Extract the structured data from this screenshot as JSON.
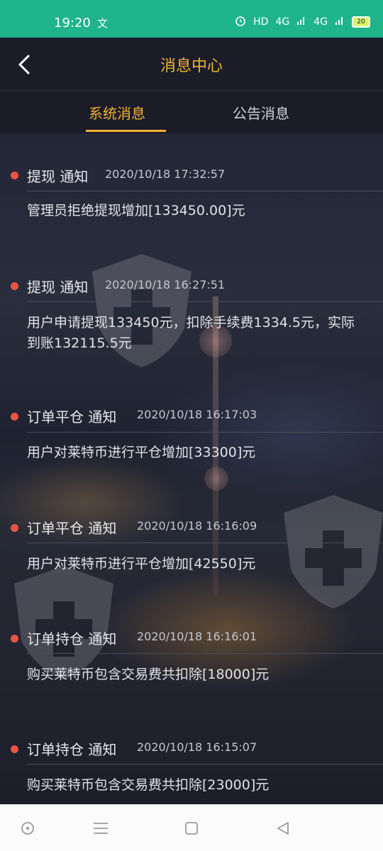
{
  "status_bar": {
    "time": "19:20",
    "sub_glyph": "文",
    "network": "HD",
    "signal1": "4G",
    "signal2": "4G",
    "battery": "20"
  },
  "header": {
    "title": "消息中心"
  },
  "tabs": [
    {
      "label": "系统消息",
      "active": true
    },
    {
      "label": "公告消息",
      "active": false
    }
  ],
  "messages": [
    {
      "type": "提现 通知",
      "time": "2020/10/18 17:32:57",
      "body": "管理员拒绝提现增加[133450.00]元"
    },
    {
      "type": "提现 通知",
      "time": "2020/10/18 16:27:51",
      "body": "用户申请提现133450元，扣除手续费1334.5元，实际到账132115.5元"
    },
    {
      "type": "订单平仓 通知",
      "time": "2020/10/18 16:17:03",
      "body": "用户对莱特币进行平仓增加[33300]元"
    },
    {
      "type": "订单平仓 通知",
      "time": "2020/10/18 16:16:09",
      "body": "用户对莱特币进行平仓增加[42550]元"
    },
    {
      "type": "订单持仓 通知",
      "time": "2020/10/18 16:16:01",
      "body": "购买莱特币包含交易费共扣除[18000]元"
    },
    {
      "type": "订单持仓 通知",
      "time": "2020/10/18 16:15:07",
      "body": "购买莱特币包含交易费共扣除[23000]元"
    }
  ],
  "colors": {
    "accent": "#f0b232",
    "status_bar": "#1fb489",
    "dot": "#ee5446",
    "background": "#1b1c28"
  },
  "icons": {
    "back": "chevron-left-icon",
    "alarm": "alarm-icon",
    "nav_home": "circle-dot-icon",
    "nav_menu": "menu-icon",
    "nav_recents": "square-icon",
    "nav_back": "triangle-back-icon"
  }
}
